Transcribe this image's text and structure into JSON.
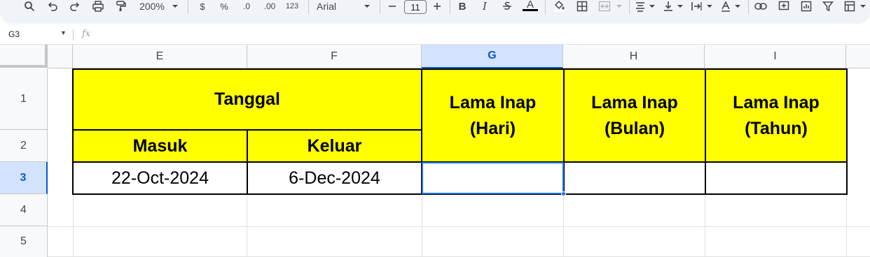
{
  "toolbar": {
    "zoom": "200%",
    "currency_symbol": "$",
    "percent_symbol": "%",
    "decrease_decimal_label": ".0",
    "increase_decimal_label": ".00",
    "number_format_label": "123",
    "font_family": "Arial",
    "font_size": "11",
    "bold_label": "B",
    "italic_label": "I",
    "text_color_label": "A",
    "accent_color": "#0b57d0",
    "icons": [
      "search-icon",
      "undo-icon",
      "redo-icon",
      "print-icon",
      "paint-format-icon",
      "chevron-down-icon",
      "minus-icon",
      "plus-icon",
      "strikethrough-icon",
      "fill-color-icon",
      "borders-icon",
      "merge-cells-icon",
      "horizontal-align-icon",
      "vertical-align-icon",
      "text-wrap-icon",
      "text-rotation-icon",
      "link-icon",
      "comment-icon",
      "chart-icon",
      "filter-icon",
      "table-view-icon"
    ]
  },
  "formula_bar": {
    "name_box": "G3",
    "fx_label": "fx",
    "value": ""
  },
  "grid": {
    "columns": [
      "E",
      "F",
      "G",
      "H",
      "I"
    ],
    "selected_column": "G",
    "rows": [
      "1",
      "2",
      "3",
      "4",
      "5"
    ],
    "selected_row": "3",
    "cells": {
      "tanggal": "Tanggal",
      "masuk": "Masuk",
      "keluar": "Keluar",
      "lama_hari_line1": "Lama Inap",
      "lama_hari_line2": "(Hari)",
      "lama_bulan_line1": "Lama Inap",
      "lama_bulan_line2": "(Bulan)",
      "lama_tahun_line1": "Lama Inap",
      "lama_tahun_line2": "(Tahun)",
      "e3": "22-Oct-2024",
      "f3": "6-Dec-2024",
      "g3": "",
      "h3": "",
      "i3": ""
    },
    "header_fill_color": "#ffff00",
    "selection_color": "#1a73e8"
  }
}
